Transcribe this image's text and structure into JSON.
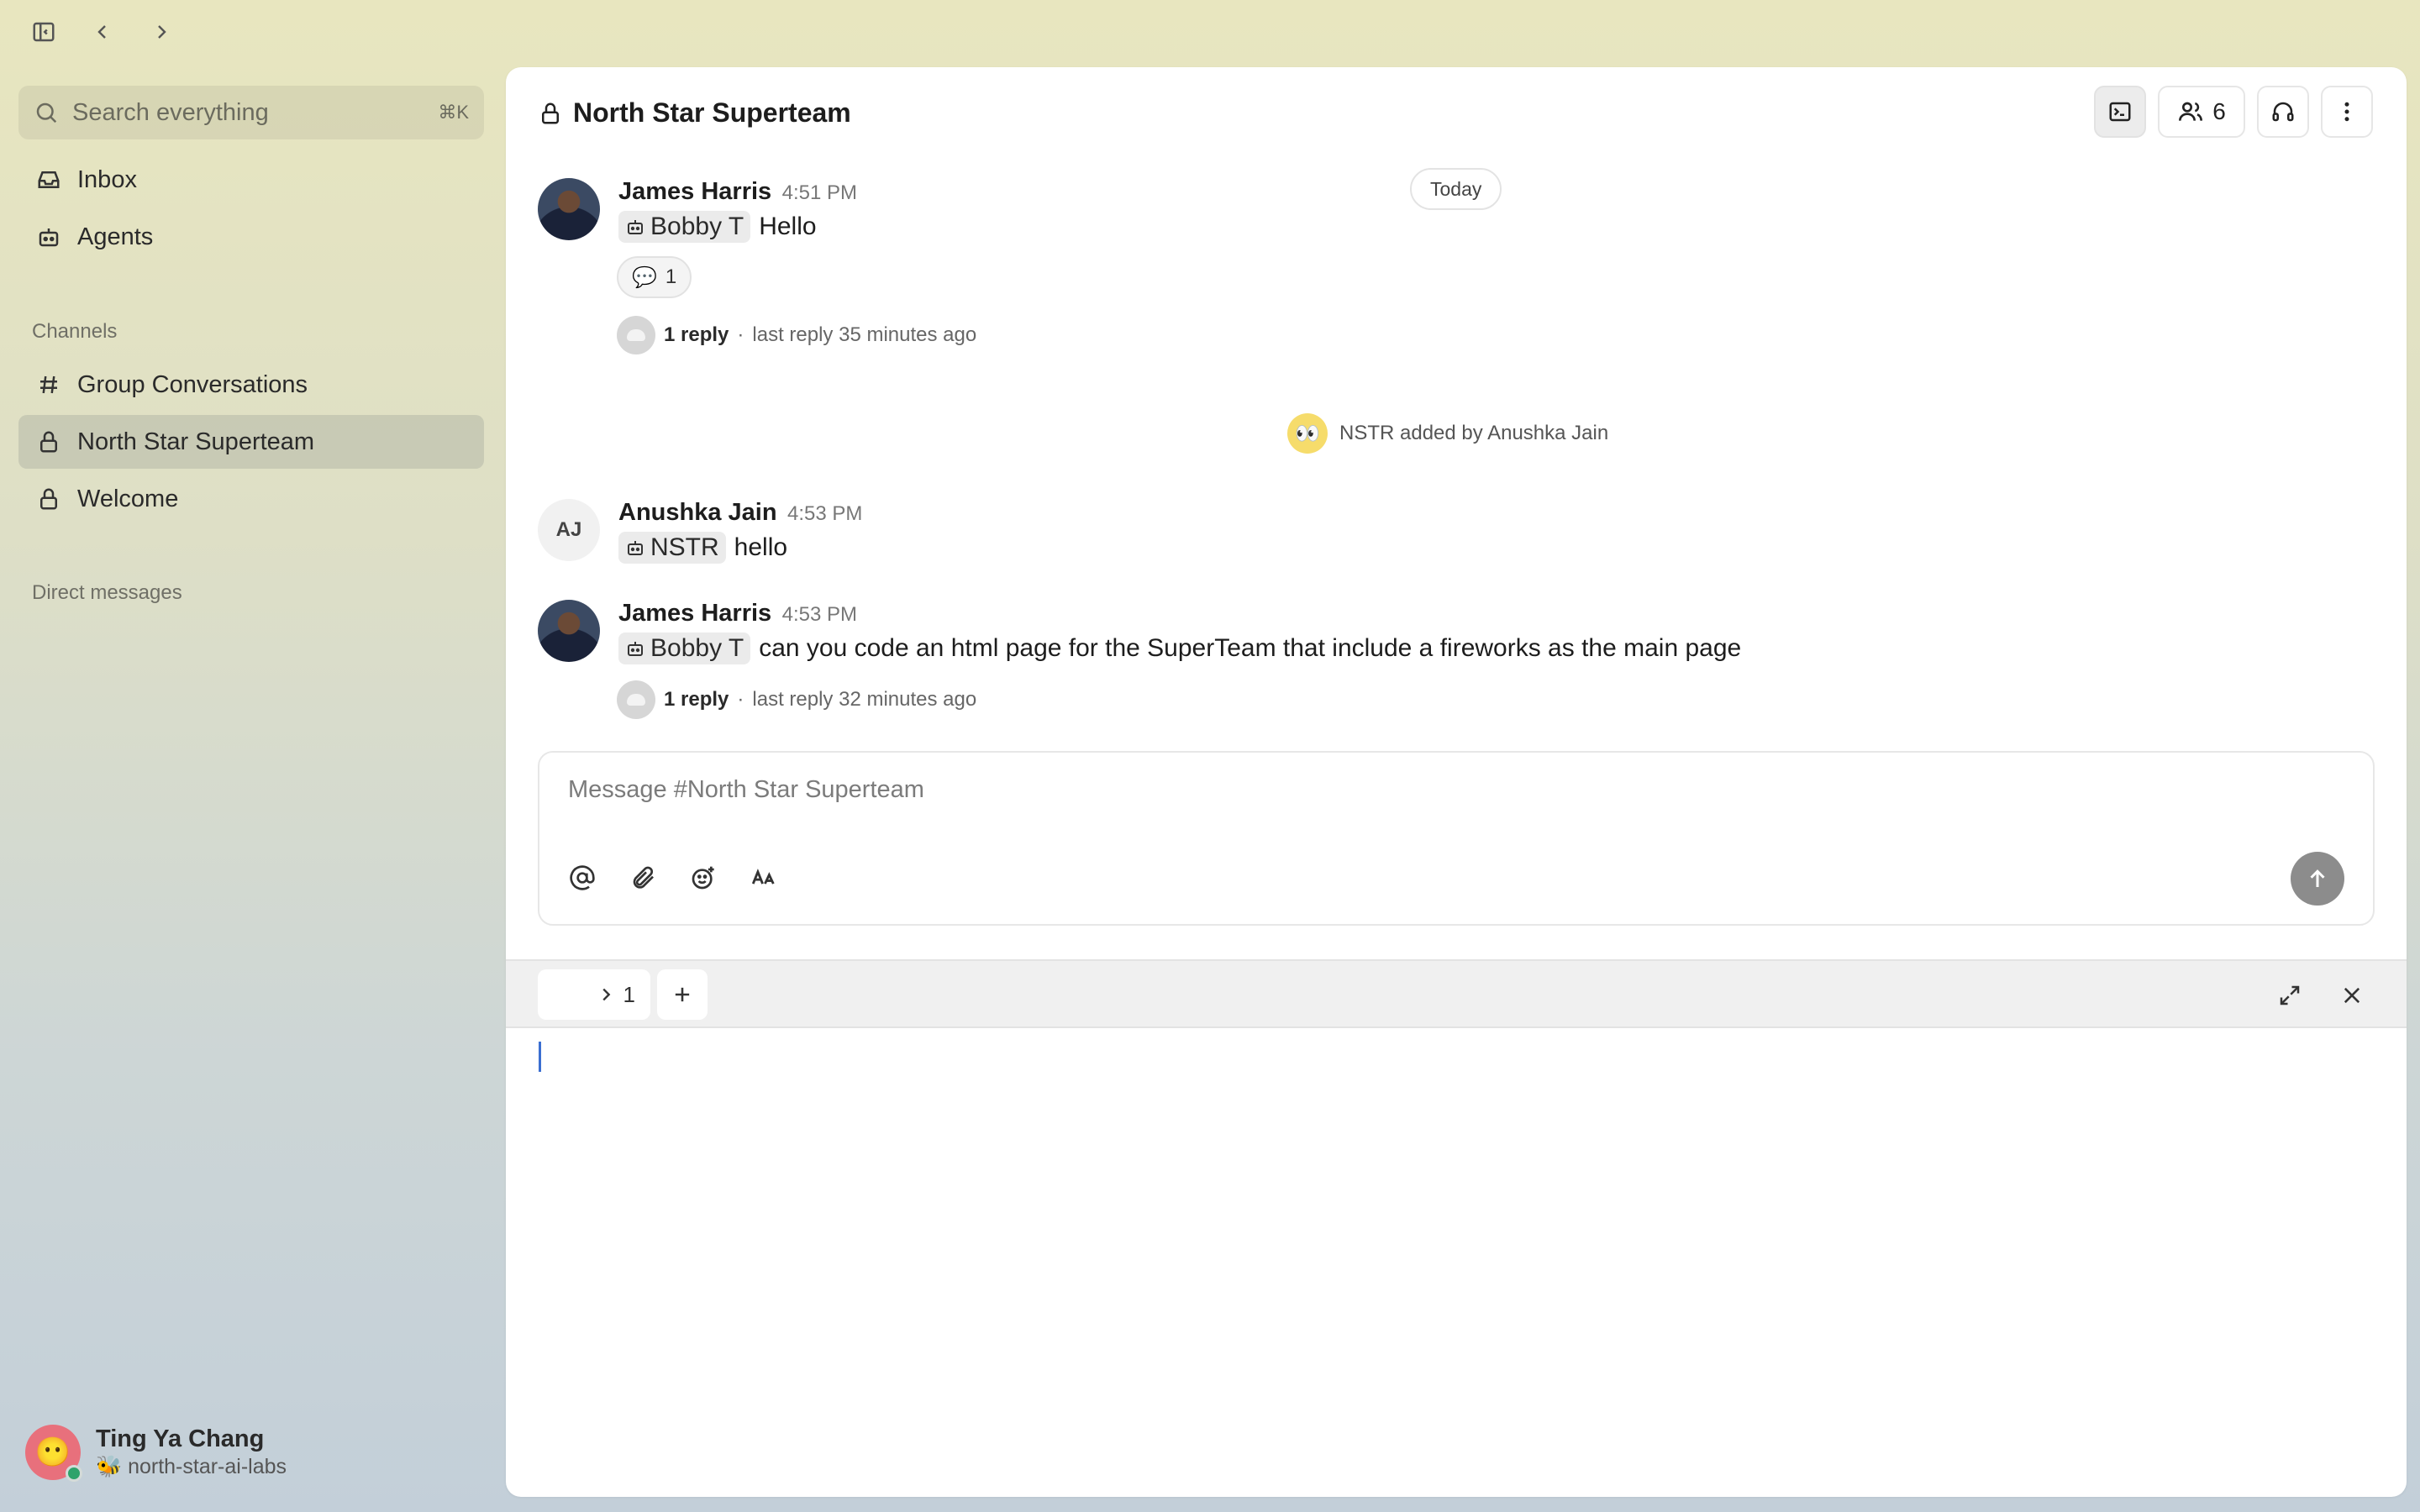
{
  "sidebar": {
    "search_placeholder": "Search everything",
    "search_shortcut": "⌘K",
    "top_items": [
      {
        "label": "Inbox",
        "icon": "inbox-icon"
      },
      {
        "label": "Agents",
        "icon": "bot-icon"
      }
    ],
    "channels_heading": "Channels",
    "channels": [
      {
        "label": "Group Conversations",
        "icon": "hash-icon"
      },
      {
        "label": "North Star Superteam",
        "icon": "lock-icon",
        "active": true
      },
      {
        "label": "Welcome",
        "icon": "lock-icon"
      }
    ],
    "dm_heading": "Direct messages",
    "user": {
      "name": "Ting Ya Chang",
      "org": "🐝 north-star-ai-labs",
      "avatar_emoji": "😶",
      "status": "online"
    }
  },
  "channel": {
    "title": "North Star Superteam",
    "member_count": "6"
  },
  "date_divider": "Today",
  "messages": [
    {
      "author": "James Harris",
      "time": "4:51 PM",
      "mention": "Bobby T",
      "text": "Hello",
      "reaction": {
        "emoji": "💬",
        "count": "1"
      },
      "reply_count": "1 reply",
      "last_reply": "last reply 35 minutes ago"
    },
    {
      "author": "Anushka Jain",
      "time": "4:53 PM",
      "initials": "AJ",
      "mention": "NSTR",
      "text": "hello"
    },
    {
      "author": "James Harris",
      "time": "4:53 PM",
      "mention": "Bobby T",
      "text": "can you code an html page for the SuperTeam that include a fireworks as the main page",
      "reply_count": "1 reply",
      "last_reply": "last reply 32 minutes ago"
    }
  ],
  "system_event": {
    "emoji": "👀",
    "text": "NSTR added by Anushka Jain"
  },
  "composer": {
    "placeholder": "Message #North Star Superteam"
  },
  "terminal": {
    "tab_label": "1"
  },
  "colors": {
    "accent_cursor": "#3b6fd1",
    "online": "#2fa36b",
    "send_disabled": "#8c8c8c"
  }
}
